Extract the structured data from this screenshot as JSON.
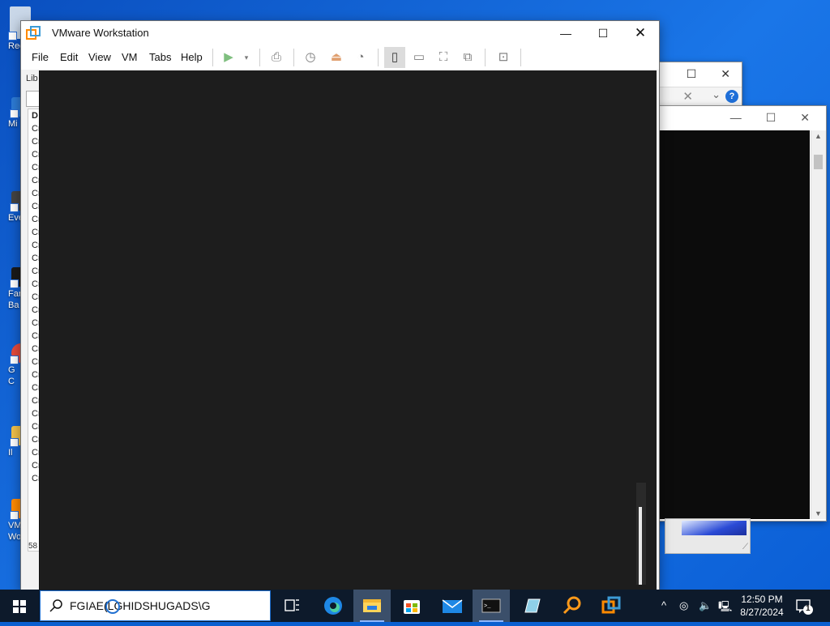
{
  "desktop": {
    "icons": [
      {
        "label": "Rec",
        "color": "#c9d7e8"
      },
      {
        "label": "Mi",
        "color": "#2d7bd6"
      },
      {
        "label": "Eve",
        "color": "#444444"
      },
      {
        "label": "Far",
        "sublabel": "Ba",
        "color": "#1a1a1a"
      },
      {
        "label": "G",
        "sublabel": "C",
        "color": "#e64a3b"
      },
      {
        "label": "Il",
        "color": "#f2c14a"
      },
      {
        "label": "VM",
        "sublabel": "Wor",
        "color": "#ff8a00"
      }
    ]
  },
  "vmware": {
    "title": "VMware Workstation",
    "menu": [
      "File",
      "Edit",
      "View",
      "VM",
      "Tabs",
      "Help"
    ],
    "library_label": "Lib",
    "library_items": [
      "Cr",
      "Cr",
      "Cr",
      "Cr",
      "Cr",
      "Cr",
      "Cr",
      "Cr",
      "Cr",
      "Cr",
      "Cr",
      "Cr",
      "Cr",
      "Cr",
      "Cr",
      "Cr",
      "Cr",
      "Cr",
      "Cr",
      "Cr",
      "Cr",
      "Cr",
      "Cr",
      "Cr",
      "Cr",
      "Cr",
      "Cr",
      "Cr"
    ],
    "library_header": "D",
    "library_count": "58",
    "controls": {
      "minimize": "—",
      "maximize": "☐",
      "close": "✕"
    }
  },
  "bg_window_b": {
    "help": "?",
    "close": "✕"
  },
  "taskbar": {
    "search_value": "FGIAE(LGHIDSHUGADS\\G",
    "time": "12:50 PM",
    "date": "8/27/2024",
    "notification_count": "1",
    "apps": [
      "task-view",
      "edge",
      "file-explorer",
      "store",
      "mail",
      "terminal",
      "notepad-app",
      "search-tool",
      "vmware"
    ]
  },
  "colors": {
    "desktop": "#1a76e8",
    "taskbar": "#0d1a2b",
    "console": "#1d1d1d",
    "accent": "#1f6fd0"
  }
}
